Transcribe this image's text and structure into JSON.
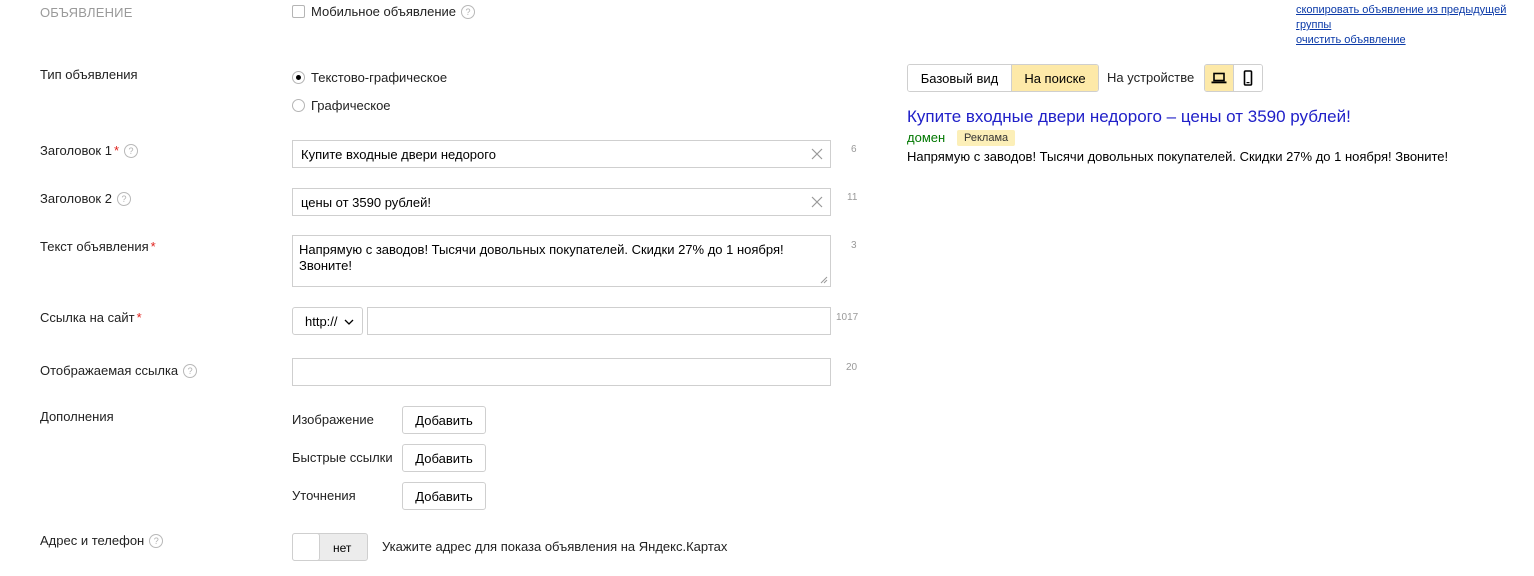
{
  "section_title": "ОБЪЯВЛЕНИЕ",
  "mobile_ad_label": "Мобильное объявление",
  "top_links": {
    "copy_line1": "скопировать объявление из предыдущей",
    "copy_line2": "группы",
    "clear": "очистить объявление"
  },
  "ad_type": {
    "label": "Тип объявления",
    "options": [
      "Текстово-графическое",
      "Графическое"
    ],
    "selected": "Текстово-графическое"
  },
  "headline1": {
    "label": "Заголовок 1",
    "value": "Купите входные двери недорого",
    "counter": "6"
  },
  "headline2": {
    "label": "Заголовок 2",
    "value": "цены от 3590 рублей!",
    "counter": "11"
  },
  "ad_text": {
    "label": "Текст объявления",
    "value": "Напрямую с заводов! Тысячи довольных покупателей. Скидки 27% до 1 ноября! Звоните!",
    "counter": "3"
  },
  "site_link": {
    "label": "Ссылка на сайт",
    "protocol": "http://",
    "value": "",
    "counter": "1017"
  },
  "display_link": {
    "label": "Отображаемая ссылка",
    "value": "",
    "counter": "20"
  },
  "extras": {
    "label": "Дополнения",
    "items": [
      {
        "label": "Изображение",
        "button": "Добавить"
      },
      {
        "label": "Быстрые ссылки",
        "button": "Добавить"
      },
      {
        "label": "Уточнения",
        "button": "Добавить"
      }
    ]
  },
  "address": {
    "label": "Адрес и телефон",
    "toggle_value": "нет",
    "hint": "Укажите адрес для показа объявления на Яндекс.Картах"
  },
  "preview": {
    "tabs": [
      "Базовый вид",
      "На поиске"
    ],
    "active_tab": "На поиске",
    "device_label": "На устройстве",
    "active_device": "desktop",
    "title": "Купите входные двери недорого – цены от 3590 рублей!",
    "domain": "домен",
    "badge": "Реклама",
    "text": "Напрямую с заводов! Тысячи довольных покупателей. Скидки 27% до 1 ноября! Звоните!"
  },
  "colors": {
    "link_blue": "#2020c8",
    "domain_green": "#007700",
    "badge_bg": "#fcefb8",
    "active_tab_bg": "#fde9a8",
    "required_red": "#e0201b"
  }
}
